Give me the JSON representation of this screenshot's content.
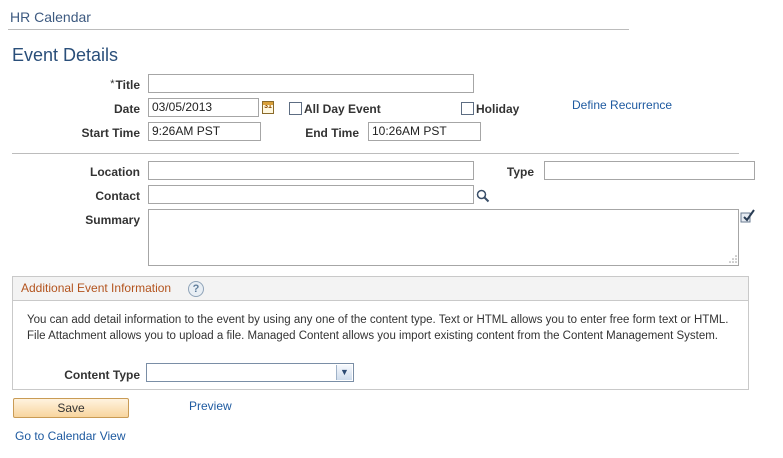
{
  "breadcrumb": "HR Calendar",
  "page_title": "Event Details",
  "form": {
    "title": {
      "required_mark": "*",
      "label": "Title",
      "value": ""
    },
    "date": {
      "label": "Date",
      "value": "03/05/2013",
      "calendar_icon": "calendar-icon"
    },
    "all_day": {
      "label": "All Day Event",
      "checked": false
    },
    "holiday": {
      "label": "Holiday",
      "checked": false
    },
    "define_recurrence": "Define Recurrence",
    "start_time": {
      "label": "Start Time",
      "value": "9:26AM PST"
    },
    "end_time": {
      "label": "End Time",
      "value": "10:26AM PST"
    },
    "location": {
      "label": "Location",
      "value": ""
    },
    "type": {
      "label": "Type",
      "value": ""
    },
    "contact": {
      "label": "Contact",
      "value": "",
      "lookup_icon": "magnifier-icon"
    },
    "summary": {
      "label": "Summary",
      "value": "",
      "spellcheck_icon": "spellcheck-icon"
    }
  },
  "additional": {
    "title": "Additional Event Information",
    "help_icon": "?",
    "description": "You can add detail information to the event by using any one of the content type.  Text or HTML allows you to enter free form text or HTML.  File Attachment allows you to upload a file.  Managed Content allows you import existing content from the Content Management System.",
    "content_type": {
      "label": "Content Type",
      "value": ""
    }
  },
  "buttons": {
    "save": "Save",
    "preview": "Preview"
  },
  "footer_link": "Go to Calendar View",
  "colors": {
    "link": "#1e5aa0",
    "section_title": "#b3541e",
    "title": "#2a4f7a",
    "save_button": "#f8d59e"
  }
}
